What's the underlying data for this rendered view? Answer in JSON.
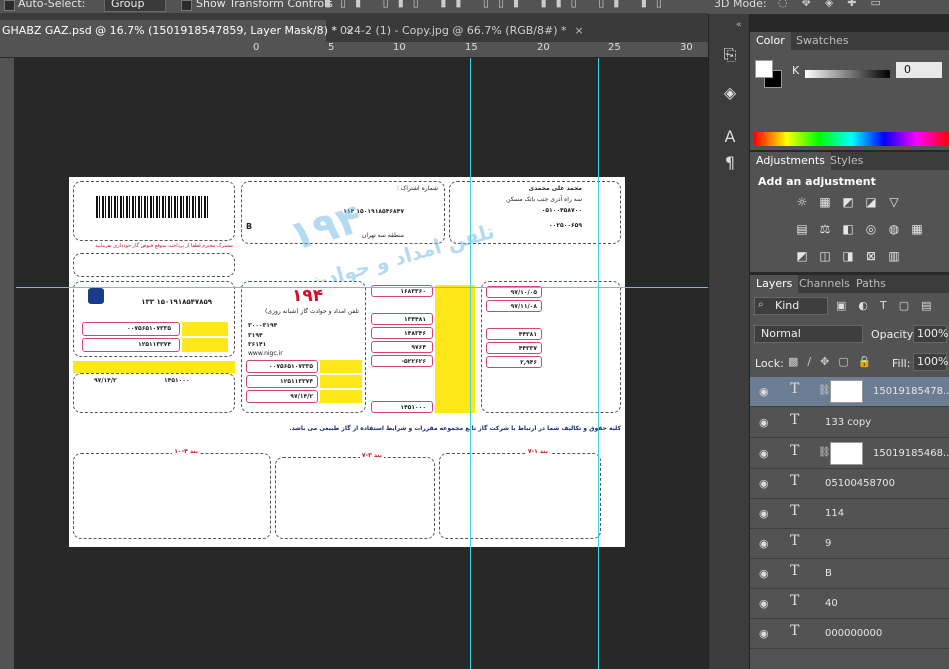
{
  "options_bar": {
    "auto_select_label": "Auto-Select:",
    "auto_select_value": "Group",
    "show_transform_label": "Show Transform Controls",
    "mode_label": "3D Mode:"
  },
  "doc_tabs": [
    {
      "label": "GHABZ GAZ.psd @ 16.7% (1501918547859, Layer Mask/8) *",
      "close": "×"
    },
    {
      "label": "024-2 (1) - Copy.jpg @ 66.7% (RGB/8#) *",
      "close": "×"
    }
  ],
  "ruler": {
    "ticks": [
      "0",
      "5",
      "10",
      "15",
      "20",
      "25",
      "30"
    ]
  },
  "color_panel": {
    "tabs": [
      "Color",
      "Swatches"
    ],
    "slider_label": "K",
    "slider_value": "0"
  },
  "adjustments_panel": {
    "tabs": [
      "Adjustments",
      "Styles"
    ],
    "title": "Add an adjustment"
  },
  "layers_panel": {
    "tabs": [
      "Layers",
      "Channels",
      "Paths"
    ],
    "filter_kind": "Kind",
    "blend_mode": "Normal",
    "opacity_label": "Opacity:",
    "opacity_value": "100%",
    "lock_label": "Lock:",
    "fill_label": "Fill:",
    "fill_value": "100%",
    "layers": [
      {
        "name": "15019185478...",
        "masked": true,
        "selected": true
      },
      {
        "name": "133 copy",
        "masked": false,
        "selected": false
      },
      {
        "name": "15019185468...",
        "masked": true,
        "selected": false
      },
      {
        "name": "05100458700",
        "masked": false,
        "selected": false
      },
      {
        "name": "114",
        "masked": false,
        "selected": false
      },
      {
        "name": "9",
        "masked": false,
        "selected": false
      },
      {
        "name": "B",
        "masked": false,
        "selected": false
      },
      {
        "name": "40",
        "masked": false,
        "selected": false
      },
      {
        "name": "000000000",
        "masked": false,
        "selected": false
      }
    ]
  },
  "bill": {
    "large_number": "۱۹۴",
    "subscriber_id": "۱۵۰۱۹۱۸۵۴۷۸۵۹ ۱۳۳",
    "amount_1": "۰۰۷۵۶۵۱۰۷۳۳۵",
    "amount_2": "۱۲۵۱۱۳۳۷۴",
    "total": "۱۴۵۱۰۰۰",
    "date": "۹۷/۱۴/۲",
    "phone": "۰۵۱۰۰۴۵۸۷۰۰",
    "mobile": "۰۰۲۵۰۰۶۵۹",
    "serial_1": "۹۷/۱۰/۰۵",
    "serial_2": "۹۷/۱۱/۰۸",
    "v1": "۱۶۸۳۳۶۰",
    "v2": "۱۳۴۴۸۱",
    "v3": "۱۴۸۳۴۶",
    "v4": "۹۷۶۴",
    "v5": "۵۲۲۶۲۶-",
    "v6": "۴۴۳۸۱",
    "v7": "۴۴۳۳۷",
    "v8": "۲,۹۴۶",
    "stamp_text": "تلفن امداد و حوادث",
    "stamp_number": "۱۹۴",
    "site_text": "www.nigc.ir",
    "note_1": "بند ۱-۷",
    "note_2": "بند ۳-۷",
    "note_3": "بند ۴-۱۰"
  }
}
